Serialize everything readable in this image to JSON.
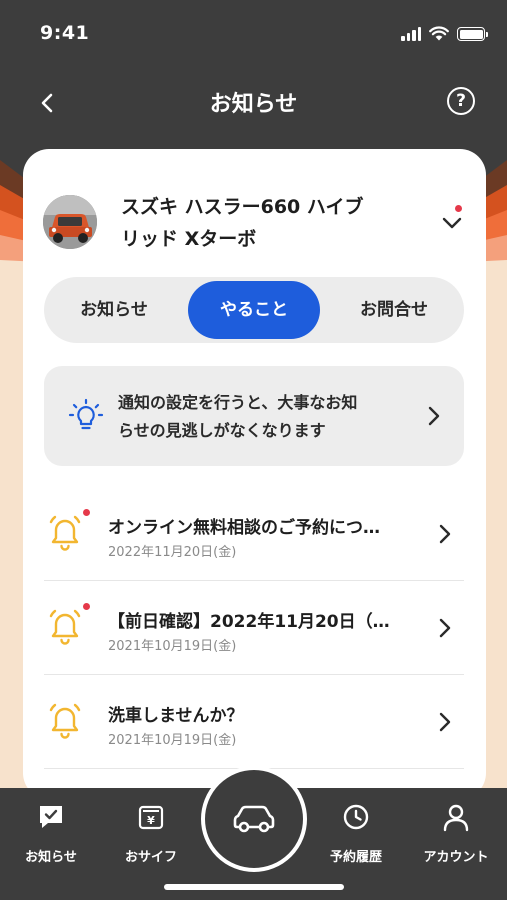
{
  "status_bar": {
    "time": "9:41"
  },
  "header": {
    "title": "お知らせ",
    "help_label": "?"
  },
  "vehicle": {
    "name": "スズキ ハスラー660 ハイブリッド Xターボ",
    "name_line1": "スズキ ハスラー660 ハイブ",
    "name_line2": "リッド Xターボ"
  },
  "tabs": [
    {
      "label": "お知らせ",
      "active": false
    },
    {
      "label": "やること",
      "active": true
    },
    {
      "label": "お問合せ",
      "active": false
    }
  ],
  "banner": {
    "line1": "通知の設定を行うと、大事なお知",
    "line2": "らせの見逃しがなくなります"
  },
  "notices": [
    {
      "title": "オンライン無料相談のご予約につ…",
      "date": "2022年11月20日(金)",
      "unread": true
    },
    {
      "title": "【前日確認】2022年11月20日（…",
      "date": "2021年10月19日(金)",
      "unread": true
    },
    {
      "title": "洗車しませんか？",
      "date": "2021年10月19日(金)",
      "unread": false
    }
  ],
  "bottom_nav": [
    {
      "label": "お知らせ",
      "icon": "message-check-icon"
    },
    {
      "label": "おサイフ",
      "icon": "wallet-yen-icon"
    },
    {
      "label": "",
      "icon": "car-icon"
    },
    {
      "label": "予約履歴",
      "icon": "clock-icon"
    },
    {
      "label": "アカウント",
      "icon": "user-icon"
    }
  ],
  "colors": {
    "accent": "#1e5ddc",
    "background": "#3d3d3d",
    "bell": "#f2b630",
    "unread_dot": "#e5394a"
  }
}
